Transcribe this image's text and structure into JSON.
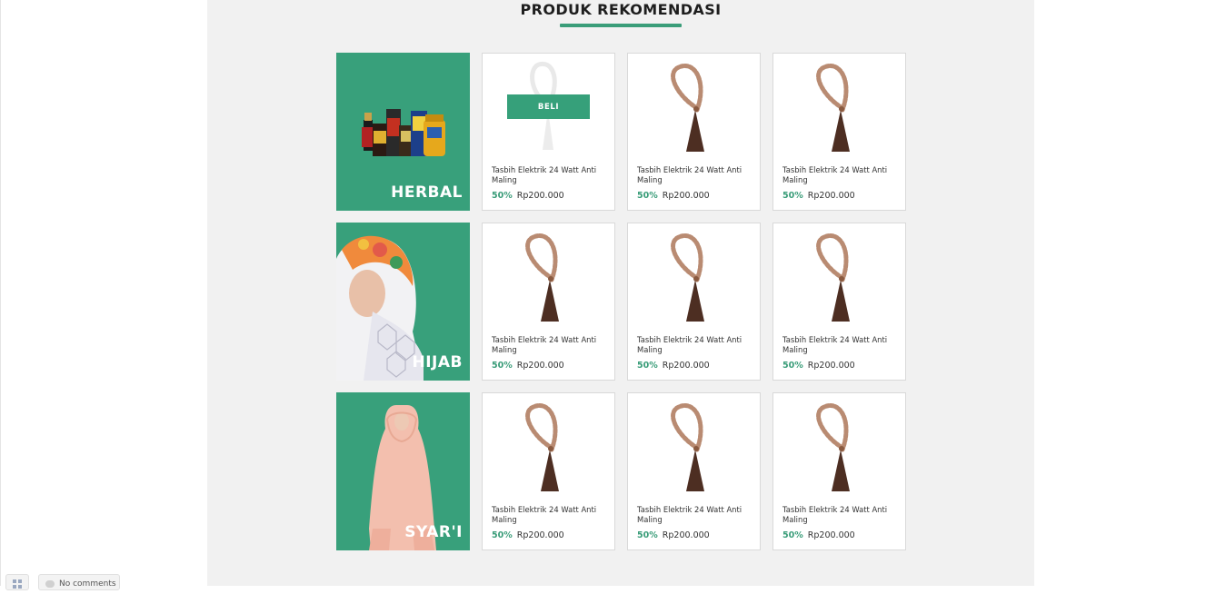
{
  "section": {
    "title": "PRODUK REKOMENDASI"
  },
  "colors": {
    "accent": "#38a07b",
    "background": "#f1f1f1"
  },
  "rows": [
    {
      "banner": {
        "label": "HERBAL",
        "image": "herbal-products-image"
      },
      "products": [
        {
          "title": "Tasbih Elektrik 24 Watt Anti Maling",
          "discount": "50%",
          "price": "Rp200.000",
          "buy_label": "BELI",
          "image": "prayer-beads-image"
        },
        {
          "title": "Tasbih Elektrik 24 Watt Anti Maling",
          "discount": "50%",
          "price": "Rp200.000",
          "image": "prayer-beads-image"
        },
        {
          "title": "Tasbih Elektrik 24 Watt Anti Maling",
          "discount": "50%",
          "price": "Rp200.000",
          "image": "prayer-beads-image"
        }
      ]
    },
    {
      "banner": {
        "label": "HIJAB",
        "image": "hijab-model-image"
      },
      "products": [
        {
          "title": "Tasbih Elektrik 24 Watt Anti Maling",
          "discount": "50%",
          "price": "Rp200.000",
          "image": "prayer-beads-image"
        },
        {
          "title": "Tasbih Elektrik 24 Watt Anti Maling",
          "discount": "50%",
          "price": "Rp200.000",
          "image": "prayer-beads-image"
        },
        {
          "title": "Tasbih Elektrik 24 Watt Anti Maling",
          "discount": "50%",
          "price": "Rp200.000",
          "image": "prayer-beads-image"
        }
      ]
    },
    {
      "banner": {
        "label": "SYAR'I",
        "image": "syari-model-image"
      },
      "products": [
        {
          "title": "Tasbih Elektrik 24 Watt Anti Maling",
          "discount": "50%",
          "price": "Rp200.000",
          "image": "prayer-beads-image"
        },
        {
          "title": "Tasbih Elektrik 24 Watt Anti Maling",
          "discount": "50%",
          "price": "Rp200.000",
          "image": "prayer-beads-image"
        },
        {
          "title": "Tasbih Elektrik 24 Watt Anti Maling",
          "discount": "50%",
          "price": "Rp200.000",
          "image": "prayer-beads-image"
        }
      ]
    }
  ],
  "footer": {
    "comments_label": "No comments",
    "grid_icon": "grid-icon",
    "comment_icon": "comment-icon"
  }
}
